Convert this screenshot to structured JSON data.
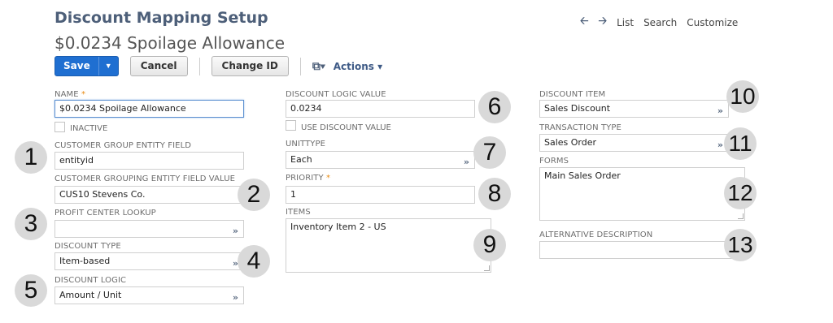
{
  "header": {
    "page_title": "Discount Mapping Setup",
    "record_title": "$0.0234 Spoilage Allowance"
  },
  "nav": {
    "back_icon": "left-arrow-icon",
    "forward_icon": "right-arrow-icon",
    "list": "List",
    "search": "Search",
    "customize": "Customize"
  },
  "toolbar": {
    "save": "Save",
    "cancel": "Cancel",
    "change_id": "Change ID",
    "actions": "Actions"
  },
  "fields": {
    "name": {
      "label": "NAME",
      "required": "*",
      "value": "$0.0234 Spoilage Allowance"
    },
    "inactive": {
      "label": "INACTIVE",
      "checked": false
    },
    "customer_group_entity_field": {
      "label": "CUSTOMER GROUP ENTITY FIELD",
      "value": "entityid"
    },
    "customer_grouping_entity_field_value": {
      "label": "CUSTOMER GROUPING ENTITY FIELD VALUE",
      "value": "CUS10 Stevens Co."
    },
    "profit_center_lookup": {
      "label": "PROFIT CENTER LOOKUP",
      "value": ""
    },
    "discount_type": {
      "label": "DISCOUNT TYPE",
      "value": "Item-based"
    },
    "discount_logic": {
      "label": "DISCOUNT LOGIC",
      "value": "Amount / Unit"
    },
    "discount_logic_value": {
      "label": "DISCOUNT LOGIC VALUE",
      "value": "0.0234"
    },
    "use_discount_value": {
      "label": "USE DISCOUNT VALUE",
      "checked": false
    },
    "unittype": {
      "label": "UNITTYPE",
      "value": "Each"
    },
    "priority": {
      "label": "PRIORITY",
      "required": "*",
      "value": "1"
    },
    "items": {
      "label": "ITEMS",
      "value": "Inventory Item 2 - US"
    },
    "discount_item": {
      "label": "DISCOUNT ITEM",
      "value": "Sales Discount"
    },
    "transaction_type": {
      "label": "TRANSACTION TYPE",
      "value": "Sales Order"
    },
    "forms": {
      "label": "FORMS",
      "value": "Main Sales Order"
    },
    "alternative_description": {
      "label": "ALTERNATIVE DESCRIPTION",
      "value": ""
    }
  },
  "badges": [
    "1",
    "2",
    "3",
    "4",
    "5",
    "6",
    "7",
    "8",
    "9",
    "10",
    "11",
    "12",
    "13"
  ],
  "colors": {
    "title": "#4d5f79",
    "save_button": "#1f6fd1",
    "required_marker": "#e88b12",
    "badge_bg": "#d9d9d9"
  }
}
